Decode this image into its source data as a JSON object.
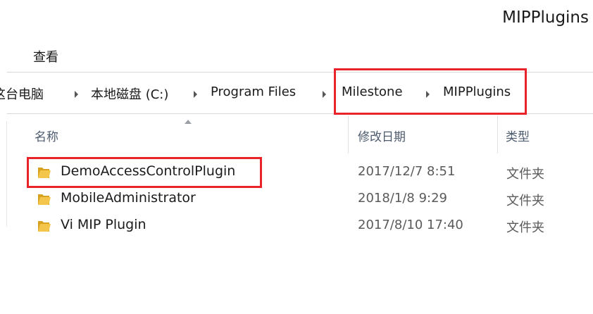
{
  "window": {
    "title": "MIPPlugins"
  },
  "ribbon": {
    "view_tab": "查看"
  },
  "address": {
    "crumbs": [
      "这台电脑",
      "本地磁盘 (C:)",
      "Program Files",
      "Milestone",
      "MIPPlugins"
    ]
  },
  "columns": {
    "name": "名称",
    "date_modified": "修改日期",
    "type": "类型"
  },
  "files": [
    {
      "name": "DemoAccessControlPlugin",
      "date": "2017/12/7 8:51",
      "type": "文件夹",
      "icon": "folder-icon"
    },
    {
      "name": "MobileAdministrator",
      "date": "2018/1/8 9:29",
      "type": "文件夹",
      "icon": "folder-icon"
    },
    {
      "name": "Vi MIP Plugin",
      "date": "2017/8/10 17:40",
      "type": "文件夹",
      "icon": "folder-icon"
    }
  ],
  "colors": {
    "highlight": "#e8232a",
    "header_text": "#4d5b6e",
    "folder_yellow": "#f3c64b",
    "folder_dark": "#d9a21e"
  }
}
